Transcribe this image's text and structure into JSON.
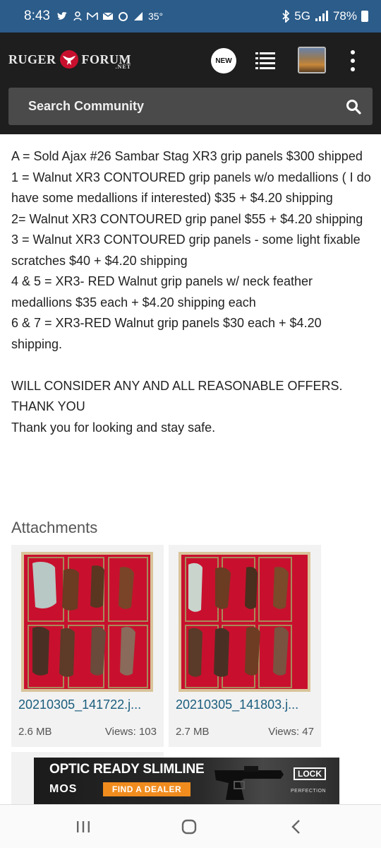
{
  "status_bar": {
    "time": "8:43",
    "temperature": "35°",
    "network": "5G",
    "battery": "78%"
  },
  "header": {
    "logo_left": "RUGER",
    "logo_right": "FORUM",
    "logo_suffix": ".NET",
    "new_label": "NEW",
    "search_placeholder": "Search Community"
  },
  "post": {
    "lines": [
      "A = Sold Ajax #26 Sambar Stag XR3 grip panels $300 shipped",
      "1 = Walnut XR3 CONTOURED grip panels w/o medallions ( I do have some medallions if interested) $35 + $4.20 shipping",
      "2= Walnut XR3 CONTOURED grip panel $55 + $4.20 shipping",
      "3 = Walnut XR3 CONTOURED grip panels - some light fixable scratches $40 + $4.20 shipping",
      "4 & 5 = XR3- RED Walnut grip panels w/ neck feather medallions $35 each + $4.20 shipping each",
      "6 & 7 = XR3-RED Walnut grip panels $30 each + $4.20 shipping.",
      "",
      "WILL CONSIDER ANY AND ALL REASONABLE OFFERS.",
      "THANK YOU",
      "Thank you for looking and stay safe."
    ]
  },
  "attachments": {
    "title": "Attachments",
    "items": [
      {
        "filename": "20210305_141722.j...",
        "size": "2.6 MB",
        "views": "Views: 103"
      },
      {
        "filename": "20210305_141803.j...",
        "size": "2.7 MB",
        "views": "Views: 47"
      }
    ]
  },
  "ad": {
    "headline": "OPTIC READY SLIMLINE",
    "badge": "MOS",
    "cta": "FIND A DEALER",
    "brand": "LOCK",
    "tagline": "PERFECTION"
  },
  "colors": {
    "status_bar": "#2b5c8a",
    "header": "#1e1e1e",
    "search_bg": "#4a4a4a",
    "link": "#1a5d7d",
    "ad_cta": "#f08c1e",
    "grip_case_red": "#c8102e"
  }
}
